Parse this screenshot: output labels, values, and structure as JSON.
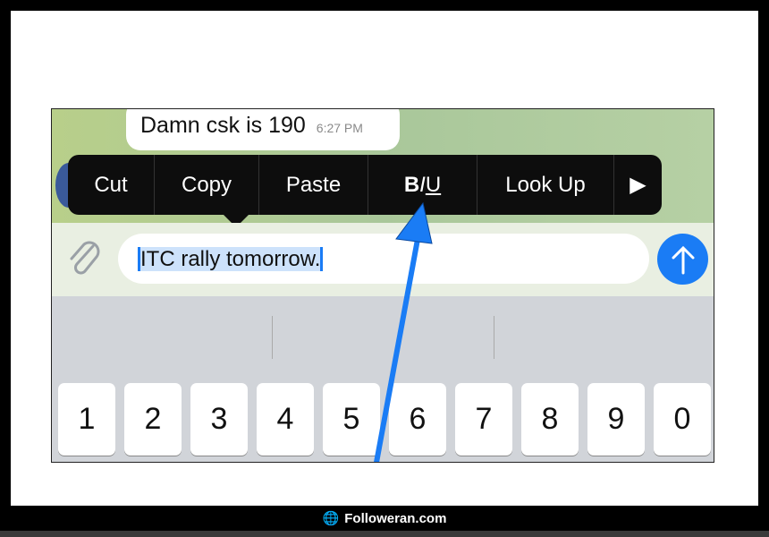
{
  "message": {
    "text": "Damn csk is 190",
    "time": "6:27 PM"
  },
  "context_menu": {
    "items": [
      "Cut",
      "Copy",
      "Paste",
      "BIU",
      "Look Up"
    ],
    "more_icon": "triangle-right-icon"
  },
  "input": {
    "value": "ITC rally tomorrow.",
    "selected": true
  },
  "keyboard": {
    "keys": [
      "1",
      "2",
      "3",
      "4",
      "5",
      "6",
      "7",
      "8",
      "9",
      "0"
    ]
  },
  "footer": {
    "brand": "Followeran.com"
  },
  "colors": {
    "accent": "#1a7cf5",
    "selection": "#cde2fb",
    "menu_bg": "#0d0d0d"
  }
}
